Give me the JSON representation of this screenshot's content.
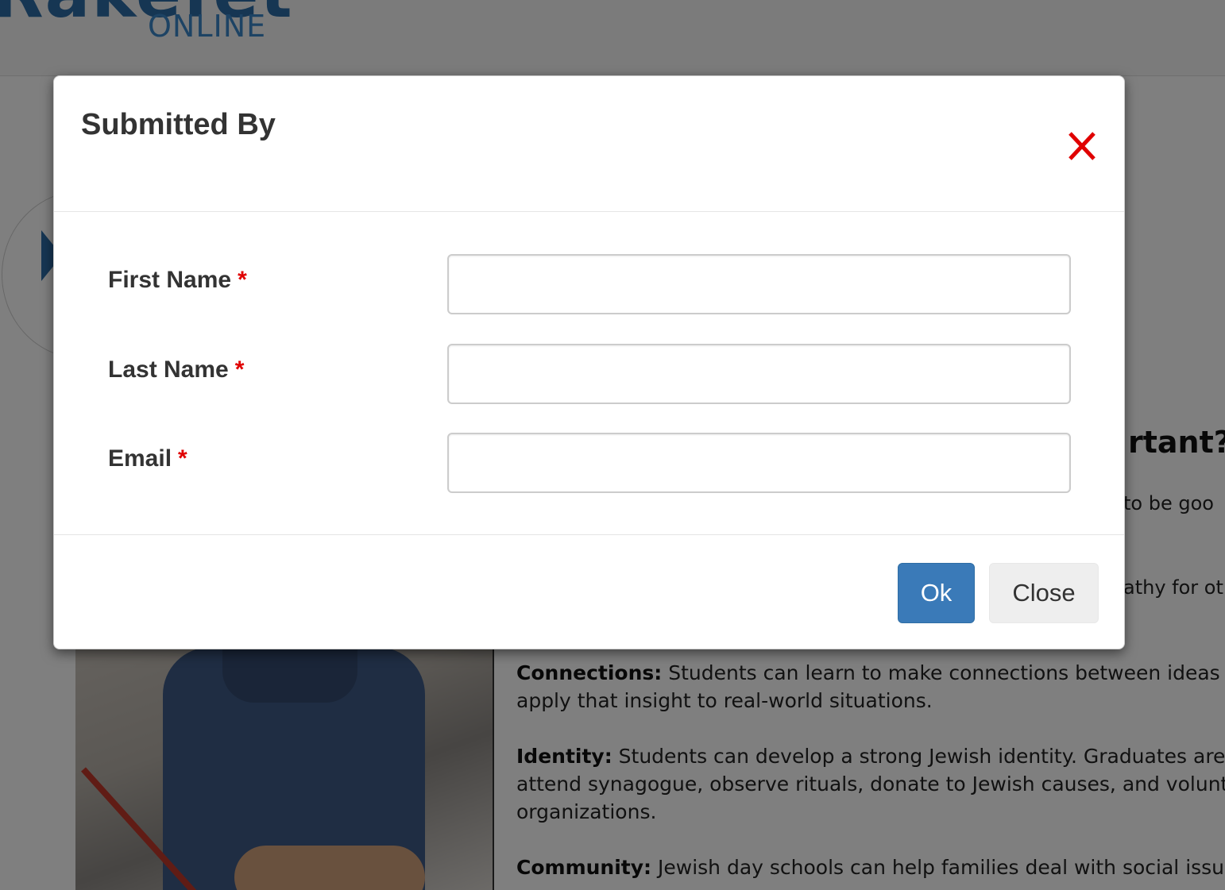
{
  "background": {
    "logo": {
      "main": "Rakefet",
      "sub": "ONLINE"
    },
    "heading_fragment": "rtant?",
    "text_fragments": [
      "to be goo",
      "athy for oth"
    ],
    "paragraphs": [
      {
        "term": "Connections:",
        "text": " Students can learn to make connections between ideas and co",
        "line2": "apply that insight to real-world situations."
      },
      {
        "term": "Identity:",
        "text": " Students can develop a strong Jewish identity. Graduates are more",
        "line2": "attend synagogue, observe rituals, donate to Jewish causes, and volunteer fo",
        "line3": "organizations."
      },
      {
        "term": "Community:",
        "text": " Jewish day schools can help families deal with social issues and"
      }
    ]
  },
  "modal": {
    "title": "Submitted By",
    "close_icon": "close-icon",
    "fields": [
      {
        "label": "First Name",
        "required": "*",
        "value": ""
      },
      {
        "label": "Last Name",
        "required": "*",
        "value": ""
      },
      {
        "label": "Email",
        "required": "*",
        "value": ""
      }
    ],
    "buttons": {
      "ok": "Ok",
      "close": "Close"
    }
  },
  "colors": {
    "primary": "#3a7ab8",
    "required": "#e00000",
    "close_icon": "#e00000",
    "overlay": "rgba(0,0,0,0.5)"
  }
}
